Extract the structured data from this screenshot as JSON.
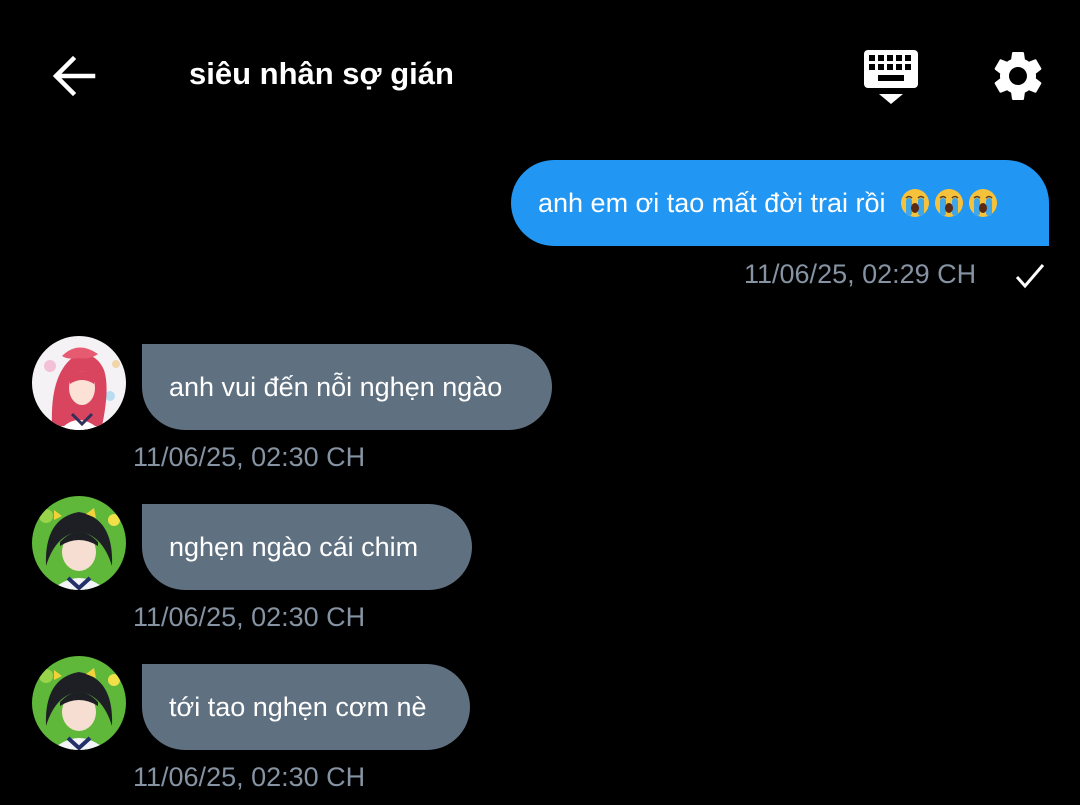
{
  "header": {
    "title": "siêu nhân sợ gián",
    "icons": {
      "back": "arrow-left-icon",
      "keyboard": "keyboard-hide-icon",
      "settings": "gear-icon"
    }
  },
  "colors": {
    "background": "#000000",
    "sent_bubble": "#2196F3",
    "received_bubble": "#5f7080",
    "timestamp": "#8593a3"
  },
  "messages": [
    {
      "direction": "sent",
      "text": "anh em ơi tao mất đời trai rồi",
      "emoji": "😭😭😭",
      "time": "11/06/25, 02:29 CH",
      "status_icon": "checkmark-icon"
    },
    {
      "direction": "received",
      "text": "anh vui đến nỗi nghẹn ngào",
      "time": "11/06/25, 02:30 CH",
      "avatar": "pink-hair-avatar"
    },
    {
      "direction": "received",
      "text": "nghẹn ngào cái chim",
      "time": "11/06/25, 02:30 CH",
      "avatar": "black-hair-avatar"
    },
    {
      "direction": "received",
      "text": "tới tao nghẹn cơm nè",
      "time": "11/06/25, 02:30 CH",
      "avatar": "black-hair-avatar"
    }
  ]
}
